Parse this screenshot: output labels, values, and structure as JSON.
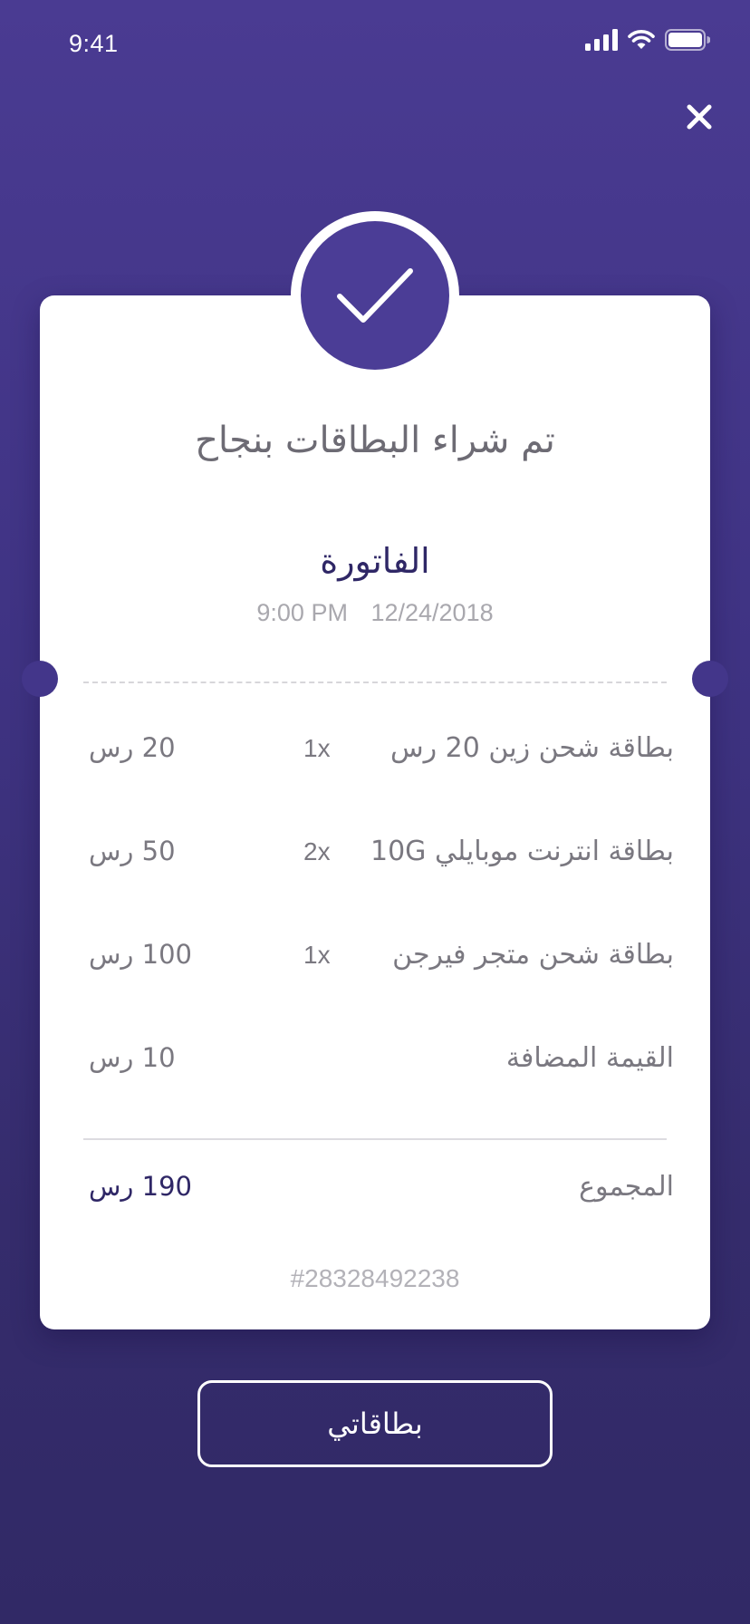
{
  "status_bar": {
    "time": "9:41"
  },
  "header": {
    "close_icon": "close-icon"
  },
  "receipt": {
    "success_message": "تم شراء البطاقات بنجاح",
    "invoice_title": "الفاتورة",
    "time": "9:00 PM",
    "date": "12/24/2018",
    "items": [
      {
        "name": "بطاقة شحن زين 20 رس",
        "qty": "1x",
        "price": "20 رس"
      },
      {
        "name": "بطاقة انترنت موبايلي 10G",
        "qty": "2x",
        "price": "50 رس"
      },
      {
        "name": "بطاقة شحن متجر فيرجن",
        "qty": "1x",
        "price": "100 رس"
      }
    ],
    "vat": {
      "label": "القيمة المضافة",
      "price": "10 رس"
    },
    "total": {
      "label": "المجموع",
      "price": "190 رس"
    },
    "order_id": "#28328492238"
  },
  "actions": {
    "my_cards_label": "بطاقاتي"
  },
  "colors": {
    "background_top": "#4a3b92",
    "background_bottom": "#312966",
    "accent": "#4b3d96",
    "text_dark": "#2f2766",
    "text_muted": "#7a7880"
  }
}
